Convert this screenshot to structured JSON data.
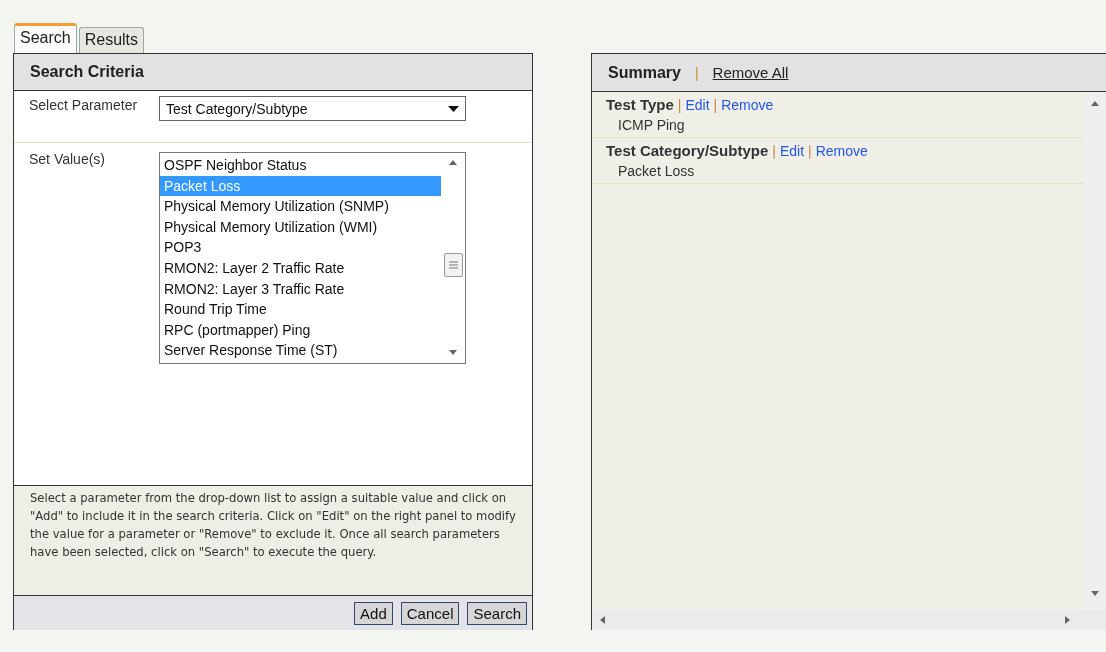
{
  "tabs": [
    {
      "label": "Search",
      "selected": true
    },
    {
      "label": "Results",
      "selected": false
    }
  ],
  "search_panel": {
    "title": "Search Criteria",
    "parameter": {
      "label": "Select Parameter",
      "value": "Test Category/Subtype"
    },
    "values": {
      "label": "Set Value(s)",
      "items": [
        {
          "text": "OSPF Neighbor Status",
          "selected": false
        },
        {
          "text": "Packet Loss",
          "selected": true
        },
        {
          "text": "Physical Memory Utilization (SNMP)",
          "selected": false
        },
        {
          "text": "Physical Memory Utilization (WMI)",
          "selected": false
        },
        {
          "text": "POP3",
          "selected": false
        },
        {
          "text": "RMON2: Layer 2 Traffic Rate",
          "selected": false
        },
        {
          "text": "RMON2: Layer 3 Traffic Rate",
          "selected": false
        },
        {
          "text": "Round Trip Time",
          "selected": false
        },
        {
          "text": "RPC (portmapper) Ping",
          "selected": false
        },
        {
          "text": "Server Response Time (ST)",
          "selected": false
        }
      ]
    },
    "help": "Select a parameter from the drop-down list to assign a suitable value and click on \"Add\" to include it in the search criteria. Click on \"Edit\" on the right panel to modify the value for a parameter or \"Remove\" to exclude it. Once all search parameters have been selected, click on \"Search\" to execute the query.",
    "buttons": [
      "Add",
      "Cancel",
      "Search"
    ]
  },
  "summary_panel": {
    "title": "Summary",
    "separator": "|",
    "remove_all": "Remove All",
    "items": [
      {
        "label": "Test Type",
        "links": [
          {
            "separator": "|",
            "text": "Edit"
          },
          {
            "separator": "|",
            "text": "Remove"
          }
        ],
        "value": "ICMP Ping"
      },
      {
        "label": "Test Category/Subtype",
        "links": [
          {
            "separator": "|",
            "text": "Edit"
          },
          {
            "separator": "|",
            "text": "Remove"
          }
        ],
        "value": "Packet Loss"
      }
    ]
  }
}
